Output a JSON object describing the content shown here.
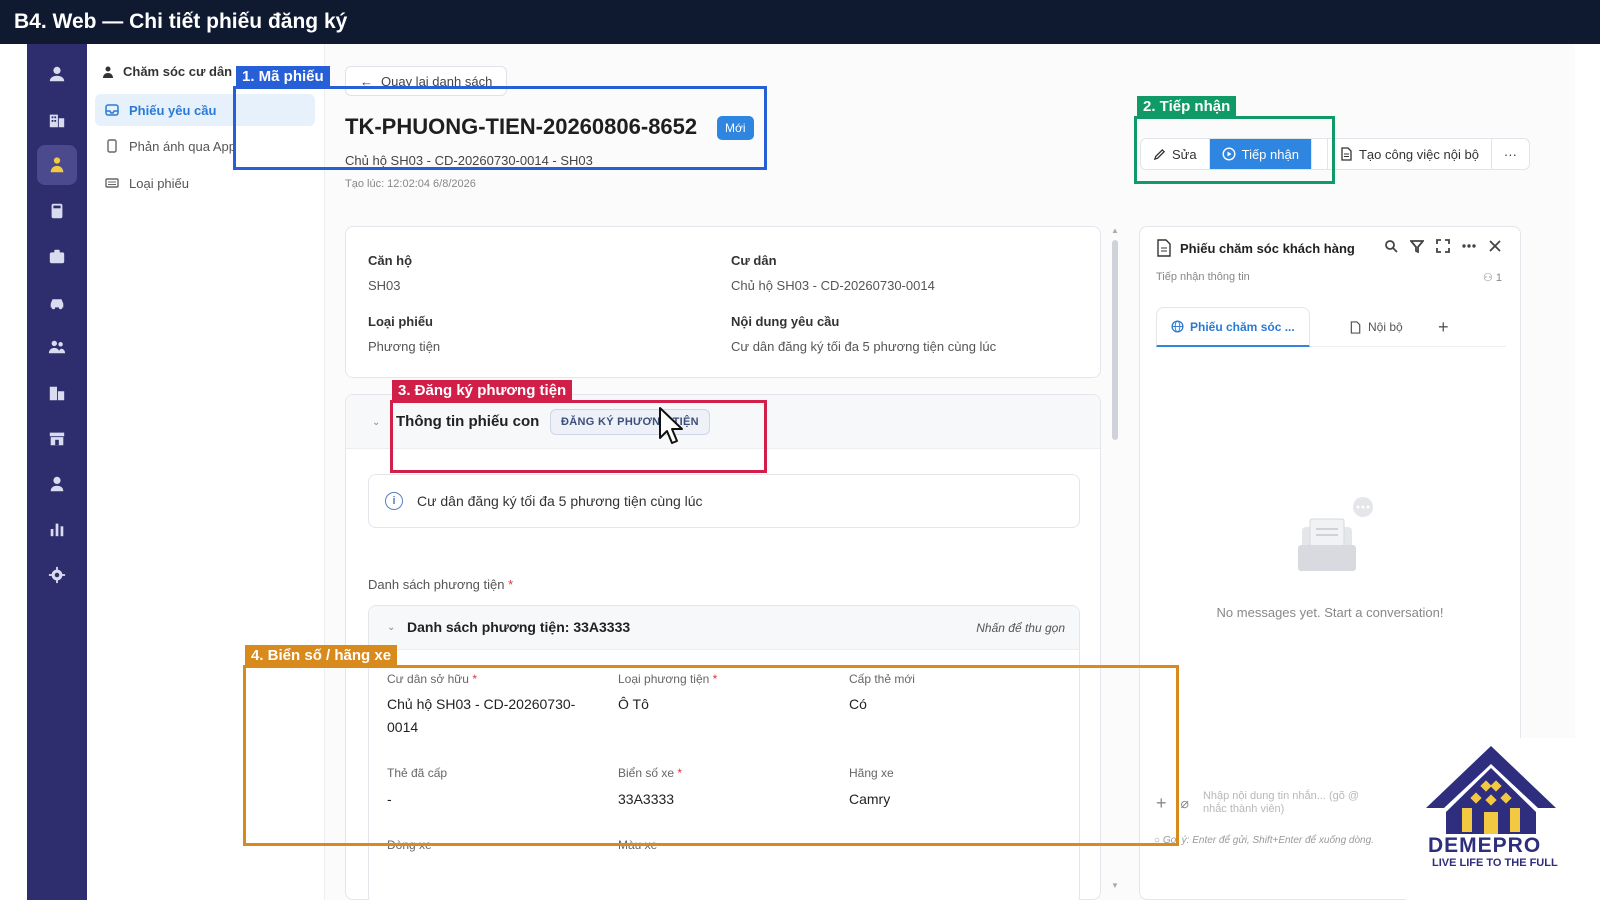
{
  "slide": {
    "title": "B4. Web — Chi tiết phiếu đăng ký"
  },
  "colors": {
    "rail_bg": "#2e2d6e",
    "primary": "#2f86e0",
    "annot_blue": "#2760d6",
    "annot_green": "#0f9a68",
    "annot_red": "#d21f4a",
    "annot_orange": "#d98a1c"
  },
  "rail": {
    "icons": [
      "user-icon",
      "building-icon",
      "resident-care-icon",
      "calculator-icon",
      "briefcase-icon",
      "car-icon",
      "people-icon",
      "buildings-icon",
      "store-icon",
      "person-icon",
      "bar-chart-icon",
      "gear-icon"
    ],
    "active_index": 2
  },
  "subnav": {
    "section": "Chăm sóc cư dân",
    "items": [
      {
        "label": "Phiếu yêu cầu",
        "active": true
      },
      {
        "label": "Phản ánh qua App",
        "active": false
      },
      {
        "label": "Loại phiếu",
        "active": false
      }
    ]
  },
  "ticket": {
    "back_label": "Quay lại danh sách",
    "code": "TK-PHUONG-TIEN-20260806-8652",
    "status_badge": "Mới",
    "subtitle": "Chủ hộ SH03 - CD-20260730-0014 - SH03",
    "created": "Tạo lúc: 12:02:04 6/8/2026"
  },
  "actions": {
    "edit": "Sửa",
    "receive": "Tiếp nhận",
    "create_task": "Tạo công việc nội bộ",
    "more": "···"
  },
  "info": {
    "apartment_label": "Căn hộ",
    "apartment_value": "SH03",
    "resident_label": "Cư dân",
    "resident_value": "Chủ hộ SH03 - CD-20260730-0014",
    "type_label": "Loại phiếu",
    "type_value": "Phương tiện",
    "content_label": "Nội dung yêu cầu",
    "content_value": "Cư dân đăng ký tối đa 5 phương tiện cùng lúc"
  },
  "child": {
    "title": "Thông tin phiếu con",
    "tag": "ĐĂNG KÝ PHƯƠNG TIỆN",
    "notice": "Cư dân đăng ký tối đa 5 phương tiện cùng lúc",
    "list_label": "Danh sách phương tiện",
    "vehicle": {
      "title": "Danh sách phương tiện: 33A3333",
      "collapse_hint": "Nhấn để thu gọn",
      "fields": {
        "owner_label": "Cư dân sở hữu",
        "owner_value_line1": "Chủ hộ SH03 - CD-20260730-",
        "owner_value_line2": "0014",
        "vtype_label": "Loại phương tiện",
        "vtype_value": "Ô Tô",
        "newcard_label": "Cấp thẻ mới",
        "newcard_value": "Có",
        "issued_label": "Thẻ đã cấp",
        "issued_value": "-",
        "plate_label": "Biển số xe",
        "plate_value": "33A3333",
        "brand_label": "Hãng xe",
        "brand_value": "Camry",
        "model_label": "Dòng xe",
        "color_label": "Màu xe"
      }
    }
  },
  "chat": {
    "title": "Phiếu chăm sóc khách hàng",
    "subtitle": "Tiếp nhận thông tin",
    "participants": "1",
    "tab_active": "Phiếu chăm sóc ...",
    "tab_internal": "Nội bộ",
    "tab_add": "+",
    "empty": "No messages yet. Start a conversation!",
    "placeholder_line1": "Nhập nội dung tin nhắn... (gõ @",
    "placeholder_line2": "nhắc thành viên)",
    "hint": "Gợi ý: Enter để gửi, Shift+Enter để xuống dòng."
  },
  "annotations": [
    {
      "label": "1. Mã phiếu",
      "color": "#2760d6"
    },
    {
      "label": "2. Tiếp nhận",
      "color": "#0f9a68"
    },
    {
      "label": "3. Đăng ký phương tiện",
      "color": "#d21f4a"
    },
    {
      "label": "4. Biển số / hãng xe",
      "color": "#d98a1c"
    }
  ],
  "logo": {
    "brand": "DEMEPRO",
    "tagline": "LIVE LIFE TO THE FULL"
  }
}
